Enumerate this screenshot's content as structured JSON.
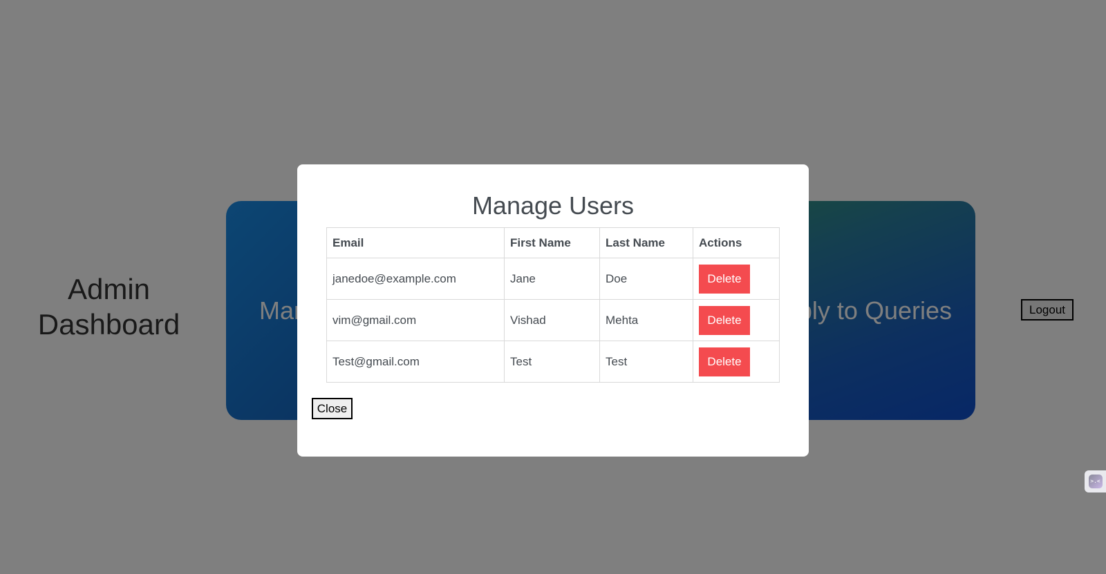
{
  "dashboard": {
    "title": "Admin Dashboard",
    "cards": {
      "manage_users_label": "Manage Users",
      "reply_queries_label": "Reply to Queries"
    },
    "logout_label": "Logout"
  },
  "modal": {
    "title": "Manage Users",
    "table": {
      "headers": [
        "Email",
        "First Name",
        "Last Name",
        "Actions"
      ],
      "rows": [
        {
          "email": "janedoe@example.com",
          "first_name": "Jane",
          "last_name": "Doe",
          "action": "Delete"
        },
        {
          "email": "vim@gmail.com",
          "first_name": "Vishad",
          "last_name": "Mehta",
          "action": "Delete"
        },
        {
          "email": "Test@gmail.com",
          "first_name": "Test",
          "last_name": "Test",
          "action": "Delete"
        }
      ]
    },
    "close_label": "Close"
  },
  "widget": {
    "icon": "assistant-face-icon",
    "glyph": ">.<"
  },
  "colors": {
    "overlay": "#000000",
    "delete_button": "#f44b4f",
    "card_users": "#1565c0",
    "card_queries": "#2a7fa0"
  }
}
